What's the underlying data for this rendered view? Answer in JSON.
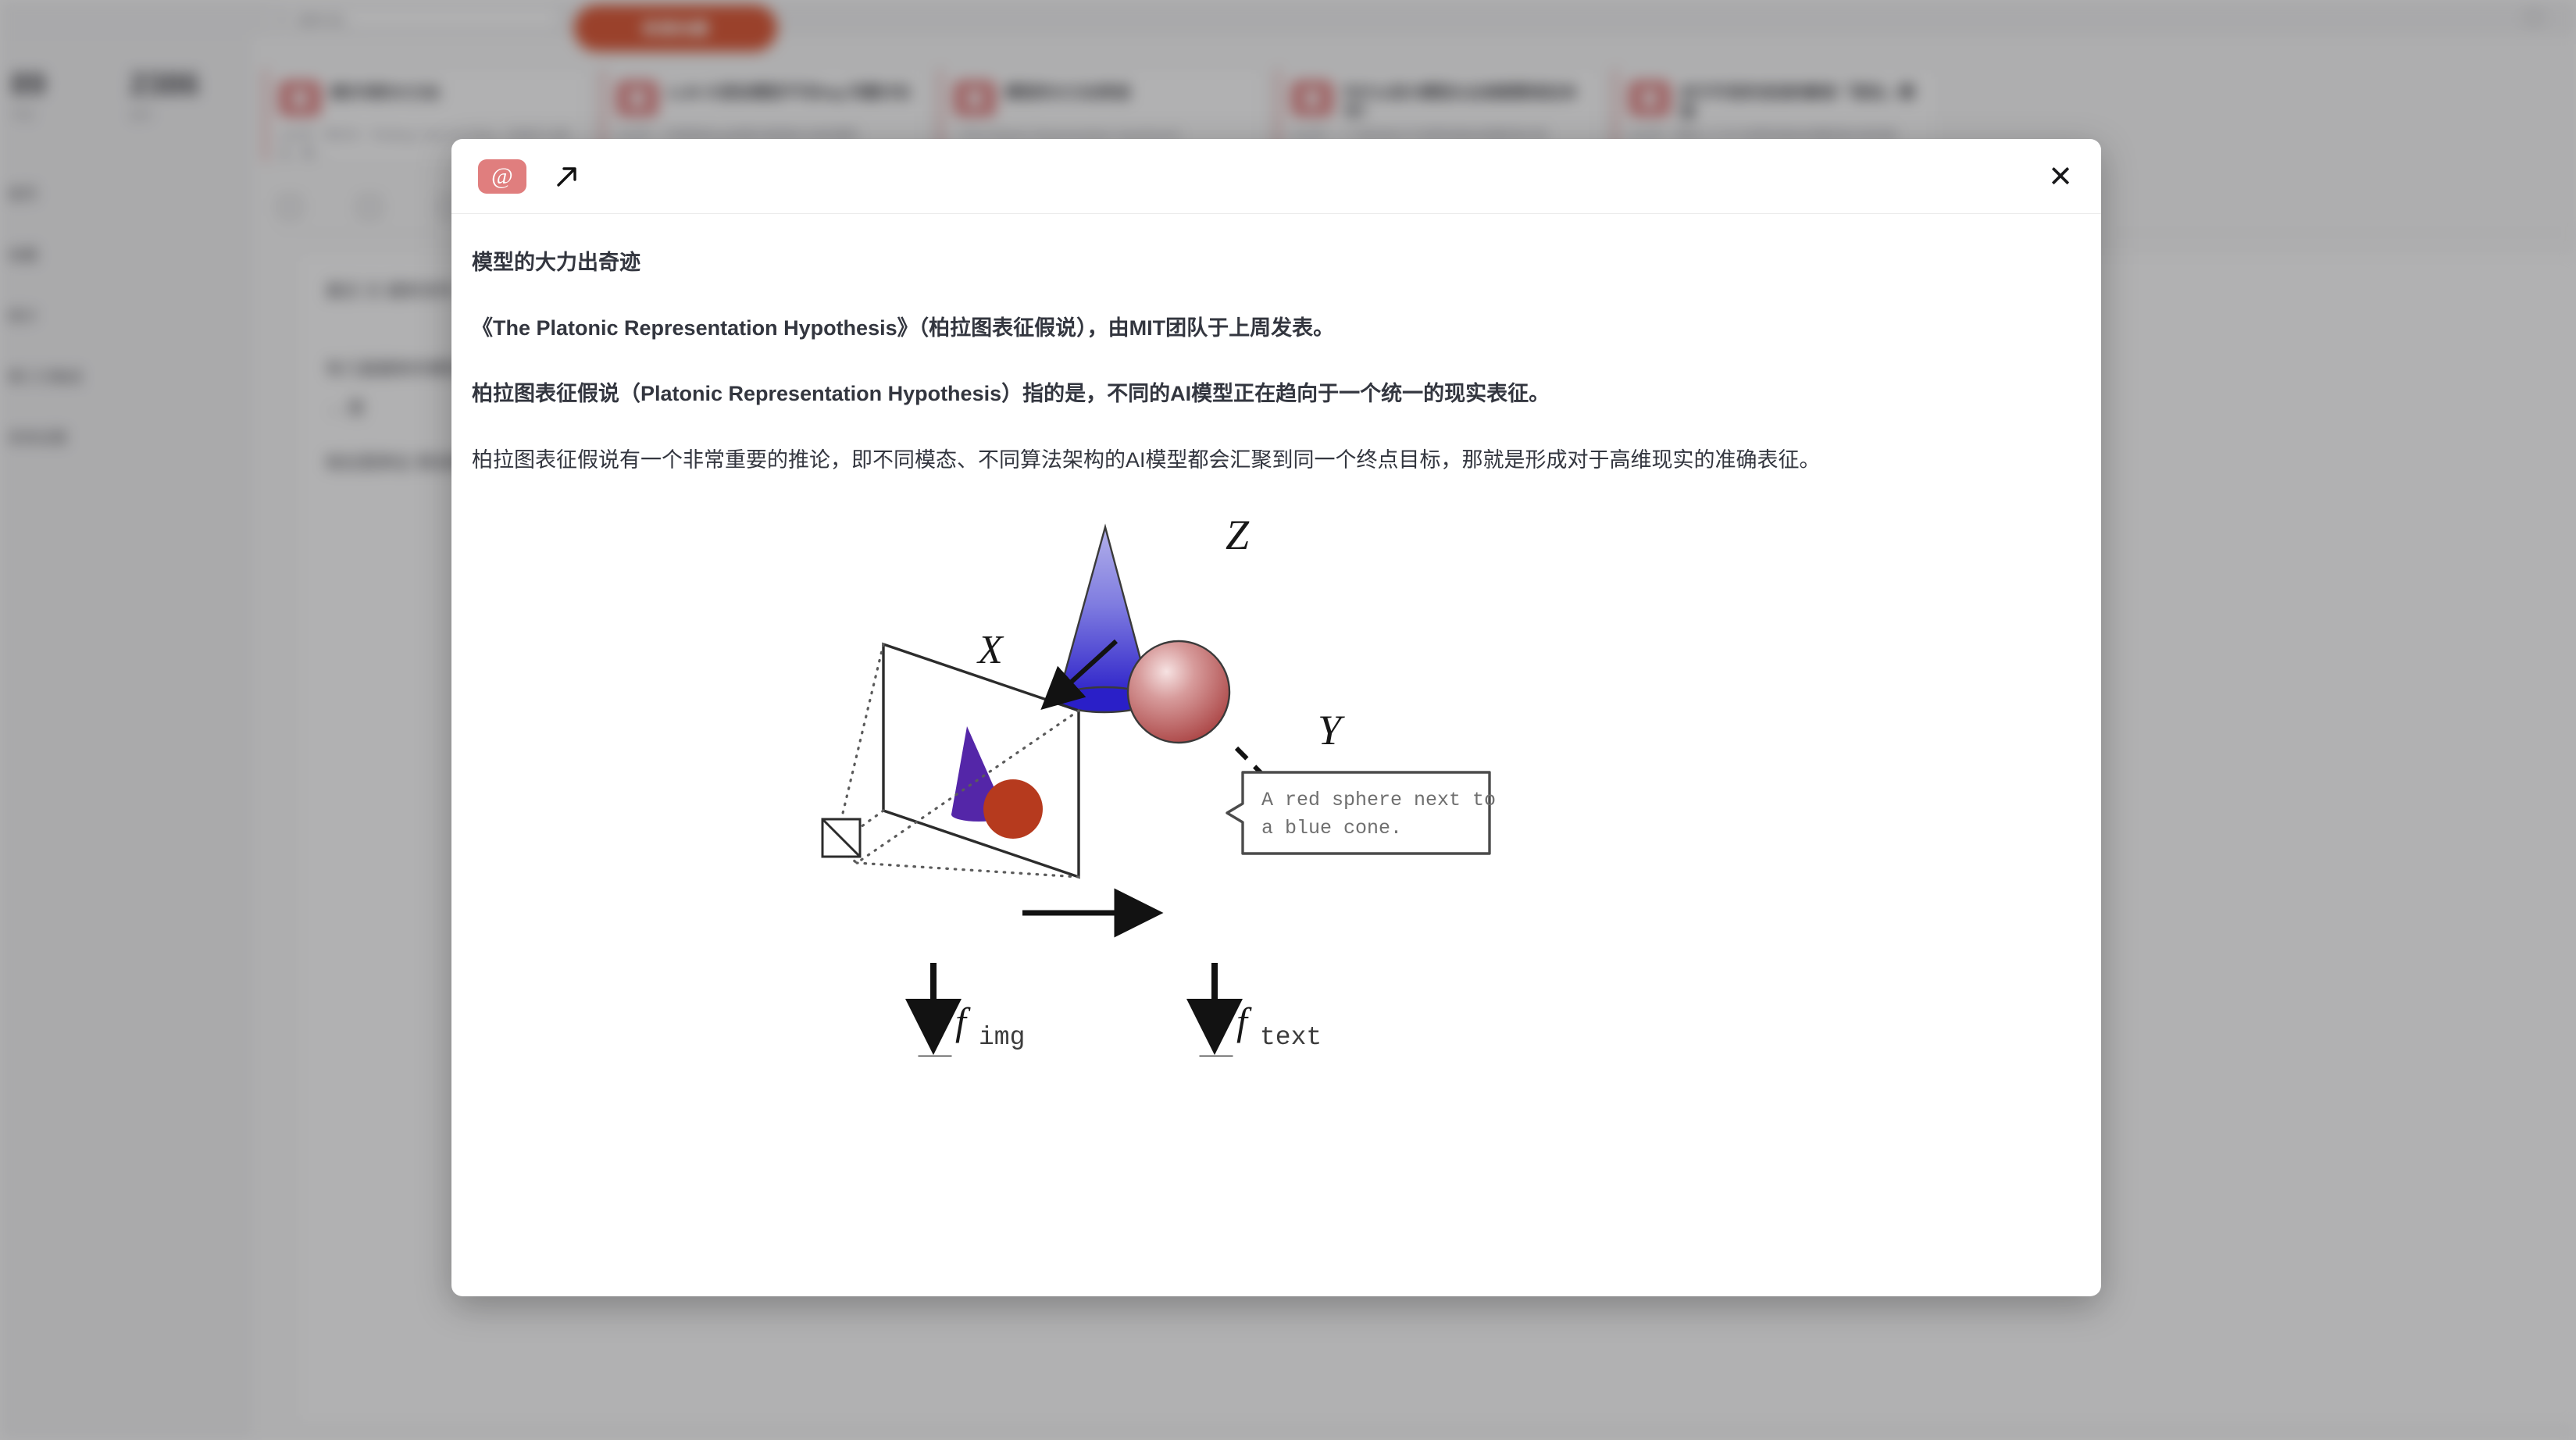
{
  "background": {
    "topbar": {
      "search_placeholder": "搜索内容...",
      "search_icon": "search-icon",
      "settings_icon": "gear-icon",
      "primary_button_label": "新建收藏"
    },
    "sidebar": {
      "stats": [
        {
          "value": "89",
          "caption": "今日"
        },
        {
          "value": "2386",
          "caption": "总计"
        }
      ],
      "menu_items": [
        {
          "label": "首页"
        },
        {
          "label": "收藏"
        },
        {
          "label": "统计"
        },
        {
          "label": "第三方集成"
        },
        {
          "label": "系统设置"
        }
      ]
    },
    "cards": [
      {
        "title": "提示词的大力出",
        "meta": "公众号 · 李方方 · Thinking, Fast and Slow、对话式 大语言、著 …"
      },
      {
        "title": "LLM 大语言模型不可Bug 问题讨论",
        "meta": "公众号 · 于视觉的Bug的提示和结构大语言模型"
      },
      {
        "title": "模型的大力出奇迹",
        "meta": "《The Platonic Representation Hypothesis》"
      },
      {
        "title": "为什么说大模型从业者都要读这本书？",
        "meta": "公众号 · 一个现代的大千世界的表征的模型表示层"
      },
      {
        "title": "关于开发的浅浅的解读「语言」模型",
        "meta": "公众号 · 现象上了大千世界的表征的模型表示层深度"
      }
    ],
    "toolbar_icons": [
      "grid-icon",
      "filter-icon",
      "list-icon"
    ],
    "panel_rows": [
      {
        "text": "最近 日 最新发布"
      },
      {
        "text": "有几篇最新的模型相关的内容"
      },
      {
        "text": "→ 是"
      },
      {
        "text": "柏拉图表征 假说推论"
      }
    ]
  },
  "modal": {
    "header": {
      "at_badge_glyph": "@",
      "at_badge_icon": "at-sign-badge",
      "external_link_icon": "external-link-icon",
      "close_icon": "close-icon",
      "close_glyph": "✕"
    },
    "document": {
      "title": "模型的大力出奇迹",
      "paragraphs": [
        "《The Platonic Representation Hypothesis》（柏拉图表征假说），由MIT团队于上周发表。",
        "柏拉图表征假说（Platonic Representation Hypothesis）指的是，不同的AI模型正在趋向于一个统一的现实表征。",
        "柏拉图表征假说有一个非常重要的推论，即不同模态、不同算法架构的AI模型都会汇聚到同一个终点目标，那就是形成对于高维现实的准确表征。"
      ]
    },
    "figure": {
      "alt_name": "platonic-representation-diagram",
      "labels": {
        "scene": "Z",
        "image_plane": "X",
        "text_modality": "Y",
        "image_encoder": "f",
        "image_encoder_sub": "img",
        "text_encoder": "f",
        "text_encoder_sub": "text"
      },
      "caption_text_line1": "A red sphere next to",
      "caption_text_line2": "a blue cone.",
      "colors": {
        "cone_top": "#b0aee8",
        "cone_bottom": "#2a1fc8",
        "sphere_highlight": "#f4dcdc",
        "sphere_body": "#b34b4b",
        "projected_cone": "#5426a8",
        "projected_sphere": "#b63a1e",
        "stroke": "#3a3a3a"
      }
    }
  }
}
